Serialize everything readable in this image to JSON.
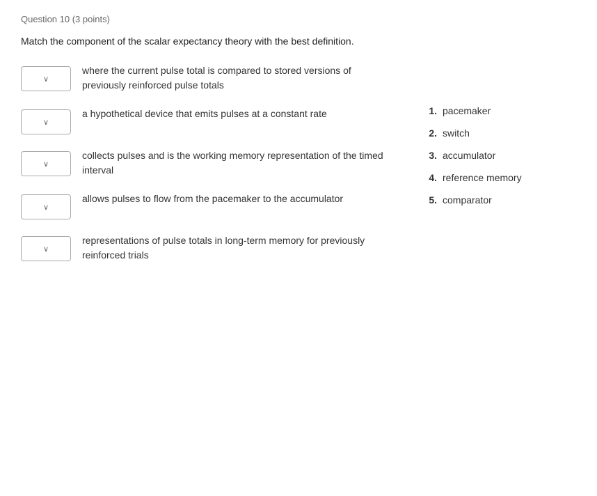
{
  "question": {
    "header": "Question 10 (3 points)",
    "instruction": "Match the component of the scalar expectancy theory with the best definition.",
    "left_items": [
      {
        "id": "item-1",
        "text": "where the current pulse total is compared to stored versions of previously reinforced pulse totals"
      },
      {
        "id": "item-2",
        "text": "a hypothetical device that emits pulses at a constant rate"
      },
      {
        "id": "item-3",
        "text": "collects pulses and is the working memory representation of the timed interval"
      },
      {
        "id": "item-4",
        "text": "allows pulses to flow from the pacemaker to the accumulator"
      },
      {
        "id": "item-5",
        "text": "representations of pulse totals in long-term memory for previously reinforced trials"
      }
    ],
    "right_items": [
      {
        "number": "1.",
        "label": "pacemaker"
      },
      {
        "number": "2.",
        "label": "switch"
      },
      {
        "number": "3.",
        "label": "accumulator"
      },
      {
        "number": "4.",
        "label": "reference memory"
      },
      {
        "number": "5.",
        "label": "comparator"
      }
    ],
    "dropdown_arrow": "∨"
  }
}
